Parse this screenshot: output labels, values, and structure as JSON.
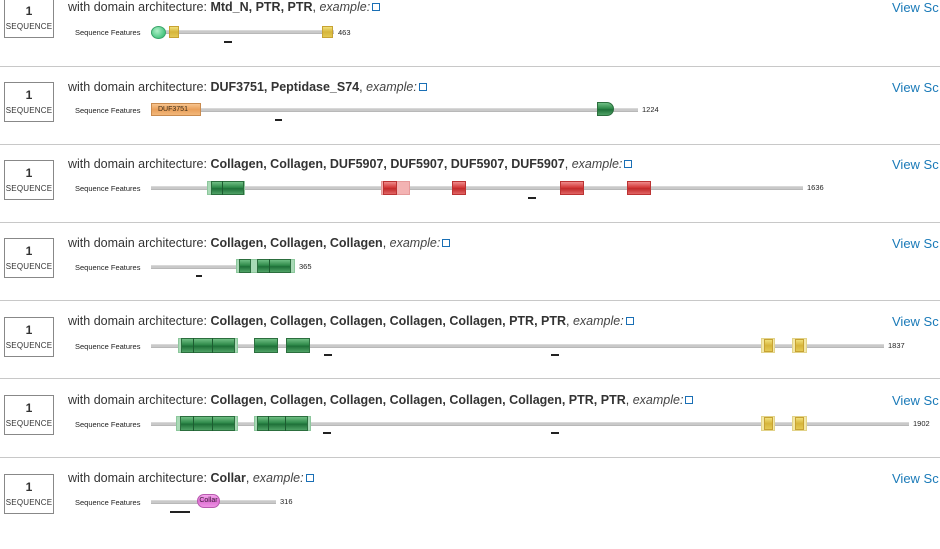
{
  "common": {
    "seq_count": "1",
    "seq_label": "SEQUENCE",
    "prefix": "with domain architecture: ",
    "example": "example:",
    "view_link": "View Sc",
    "features_label": "Sequence Features"
  },
  "rows": [
    {
      "domains": "Mtd_N, PTR, PTR",
      "length": "463"
    },
    {
      "domains": "DUF3751, Peptidase_S74",
      "length": "1224",
      "feature_text": "DUF3751"
    },
    {
      "domains": "Collagen, Collagen, DUF5907, DUF5907, DUF5907, DUF5907",
      "length": "1636"
    },
    {
      "domains": "Collagen, Collagen, Collagen",
      "length": "365"
    },
    {
      "domains": "Collagen, Collagen, Collagen, Collagen, Collagen, PTR, PTR",
      "length": "1837"
    },
    {
      "domains": "Collagen, Collagen, Collagen, Collagen, Collagen, Collagen, PTR, PTR",
      "length": "1902"
    },
    {
      "domains": "Collar",
      "length": "316",
      "feature_text": "Collar"
    }
  ],
  "colors": {
    "link": "#1a7ab8",
    "collagen": "#2f8a4a",
    "duf5907": "#d43a3a",
    "ptr": "#d6b53a",
    "duf3751": "#e9a05a",
    "collar": "#de6fd3",
    "mtd_n": "#4cc783"
  },
  "icons": [
    "external-link-icon"
  ]
}
